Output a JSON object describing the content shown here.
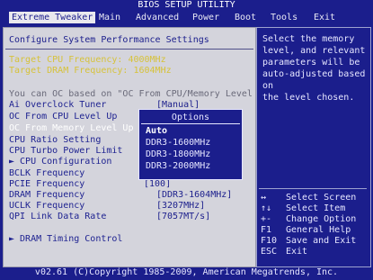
{
  "header": {
    "title": "BIOS SETUP UTILITY"
  },
  "menu": [
    {
      "label": "Extreme Tweaker"
    },
    {
      "label": "Main"
    },
    {
      "label": "Advanced"
    },
    {
      "label": "Power"
    },
    {
      "label": "Boot"
    },
    {
      "label": "Tools"
    },
    {
      "label": "Exit"
    }
  ],
  "main": {
    "heading": "Configure System Performance Settings",
    "target_cpu": "Target CPU Frequency: 4000MHz",
    "target_dram": "Target DRAM Frequency: 1604MHz",
    "oc_note": "You can OC based on \"OC From CPU/Memory Level Up\"",
    "items": [
      {
        "label": "Ai Overclock Tuner",
        "value": "[Manual]"
      },
      {
        "label": "OC From CPU Level Up",
        "value": ""
      },
      {
        "label": "OC From Memory Level Up",
        "value": ""
      },
      {
        "label": "CPU Ratio Setting",
        "value": ""
      },
      {
        "label": "CPU Turbo Power Limit",
        "value": ""
      },
      {
        "label": "► CPU Configuration",
        "value": ""
      },
      {
        "label": "BCLK Frequency",
        "value": ""
      },
      {
        "label": "PCIE Frequency",
        "value": "[100]"
      },
      {
        "label": "DRAM Frequency",
        "value": "[DDR3-1604MHz]"
      },
      {
        "label": "UCLK Frequency",
        "value": "[3207MHz]"
      },
      {
        "label": "QPI Link Data Rate",
        "value": "[7057MT/s]"
      }
    ],
    "dram_timing": "► DRAM Timing Control"
  },
  "popup": {
    "title": "Options",
    "options": [
      "Auto",
      "DDR3-1600MHz",
      "DDR3-1800MHz",
      "DDR3-2000MHz"
    ],
    "selected": "Auto"
  },
  "help": {
    "text": "Select the memory\nlevel, and relevant\nparameters will be\nauto-adjusted based on\nthe level chosen.",
    "keys": [
      {
        "key": "↔",
        "desc": "Select Screen"
      },
      {
        "key": "↑↓",
        "desc": "Select Item"
      },
      {
        "key": "+-",
        "desc": "Change Option"
      },
      {
        "key": "F1",
        "desc": "General Help"
      },
      {
        "key": "F10",
        "desc": "Save and Exit"
      },
      {
        "key": "ESC",
        "desc": "Exit"
      }
    ]
  },
  "footer": {
    "text": "v02.61 (C)Copyright 1985-2009, American Megatrends, Inc."
  },
  "colors": {
    "background": "#1b1e8c",
    "panel": "#d4d4dc",
    "highlight": "#d6c23a"
  }
}
